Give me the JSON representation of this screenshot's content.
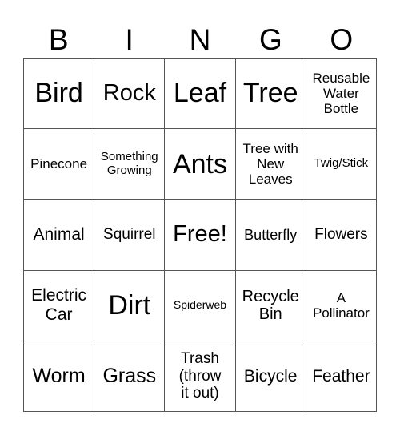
{
  "header": {
    "letters": [
      "B",
      "I",
      "N",
      "G",
      "O"
    ]
  },
  "card": {
    "rows": [
      [
        "Bird",
        "Rock",
        "Leaf",
        "Tree",
        "Reusable\nWater\nBottle"
      ],
      [
        "Pinecone",
        "Something\nGrowing",
        "Ants",
        "Tree with\nNew\nLeaves",
        "Twig/Stick"
      ],
      [
        "Animal",
        "Squirrel",
        "Free!",
        "Butterfly",
        "Flowers"
      ],
      [
        "Electric\nCar",
        "Dirt",
        "Spiderweb",
        "Recycle\nBin",
        "A\nPollinator"
      ],
      [
        "Worm",
        "Grass",
        "Trash\n(throw\nit out)",
        "Bicycle",
        "Feather"
      ]
    ],
    "free_space": "Free!"
  },
  "colors": {
    "grid_line": "#555555",
    "text": "#000000",
    "background": "#ffffff"
  }
}
